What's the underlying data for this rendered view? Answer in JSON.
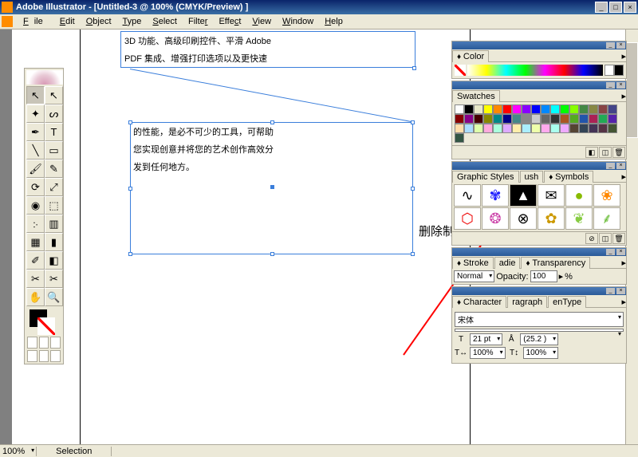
{
  "titlebar": {
    "app": "Adobe Illustrator",
    "doc": "[Untitled-3 @ 100% (CMYK/Preview) ]"
  },
  "menu": [
    "File",
    "Edit",
    "Object",
    "Type",
    "Select",
    "Filter",
    "Effect",
    "View",
    "Window",
    "Help"
  ],
  "canvas": {
    "text1_line1": "3D 功能、高级印刷控件、平滑 Adobe",
    "text1_line2": "PDF 集成、增强打印选项以及更快速",
    "text2_line1": "的性能，是必不可少的工具，可帮助",
    "text2_line2": "您实现创意并将您的艺术创作高效分",
    "text2_line3": "发到任何地方。",
    "delete_label": "删除制作"
  },
  "panels": {
    "color": "Color",
    "swatches": "Swatches",
    "graphic_styles": "Graphic Styles",
    "brushes_abbr": "ush",
    "symbols": "Symbols",
    "stroke": "Stroke",
    "gradient_abbr": "adie",
    "transparency": "Transparency",
    "character": "Character",
    "paragraph_abbr": "ragraph",
    "opentype_abbr": "enType"
  },
  "transparency": {
    "mode": "Normal",
    "opacity_label": "Opacity:",
    "opacity_val": "100",
    "pct": "%"
  },
  "character": {
    "font": "宋体",
    "size": "21 pt",
    "leading": "(25.2 )",
    "hscale": "100%",
    "vscale": "100%"
  },
  "swatch_colors": [
    "#fff",
    "#000",
    "#e8e8c8",
    "#ff0",
    "#f80",
    "#f00",
    "#f0f",
    "#80f",
    "#00f",
    "#08f",
    "#0ff",
    "#0f0",
    "#8f0",
    "#484",
    "#884",
    "#844",
    "#448",
    "#800",
    "#808",
    "#400",
    "#880",
    "#088",
    "#008",
    "#488",
    "#888",
    "#ccc",
    "#666",
    "#333",
    "#a52",
    "#5a2",
    "#25a",
    "#a25",
    "#2a5",
    "#52a",
    "#fda",
    "#adf",
    "#dfa",
    "#fad",
    "#afd",
    "#daf",
    "#fea",
    "#aef",
    "#efa",
    "#fae",
    "#afe",
    "#eaf",
    "#543",
    "#345",
    "#435",
    "#534",
    "#453",
    "#354"
  ],
  "status": {
    "zoom": "100%",
    "tool": "Selection"
  }
}
